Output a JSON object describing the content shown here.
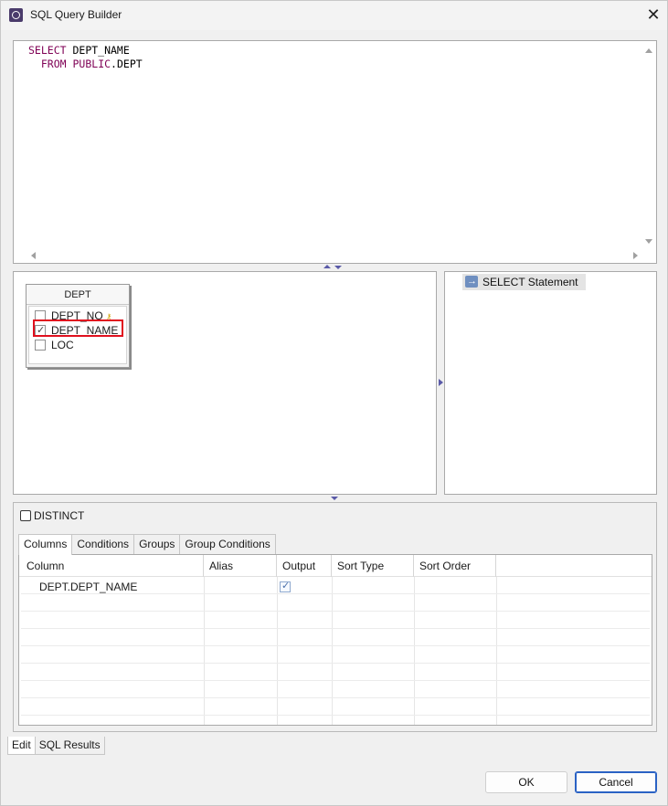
{
  "window": {
    "title": "SQL Query Builder"
  },
  "editor": {
    "lines": [
      {
        "keyword": "SELECT",
        "rest": " DEPT_NAME"
      },
      {
        "keyword": "FROM",
        "schema": "PUBLIC",
        "rest": ".DEPT"
      }
    ]
  },
  "diagram": {
    "table": {
      "name": "DEPT",
      "fields": [
        {
          "name": "DEPT_NO",
          "checked": false,
          "primary_key": true
        },
        {
          "name": "DEPT_NAME",
          "checked": true,
          "primary_key": false
        },
        {
          "name": "LOC",
          "checked": false,
          "primary_key": false
        }
      ]
    }
  },
  "tree": {
    "root_label": "SELECT Statement"
  },
  "options": {
    "distinct_label": "DISTINCT",
    "distinct_checked": false
  },
  "tabs": [
    "Columns",
    "Conditions",
    "Groups",
    "Group Conditions"
  ],
  "grid": {
    "headers": [
      "Column",
      "Alias",
      "Output",
      "Sort Type",
      "Sort Order"
    ],
    "rows": [
      {
        "column": "DEPT.DEPT_NAME",
        "alias": "",
        "output": true,
        "sort_type": "",
        "sort_order": ""
      }
    ]
  },
  "bottom_tabs": [
    "Edit",
    "SQL Results"
  ],
  "buttons": {
    "ok": "OK",
    "cancel": "Cancel"
  },
  "colors": {
    "keyword": "#7f0055",
    "highlight": "#e0101e",
    "accent": "#2a62c4"
  }
}
